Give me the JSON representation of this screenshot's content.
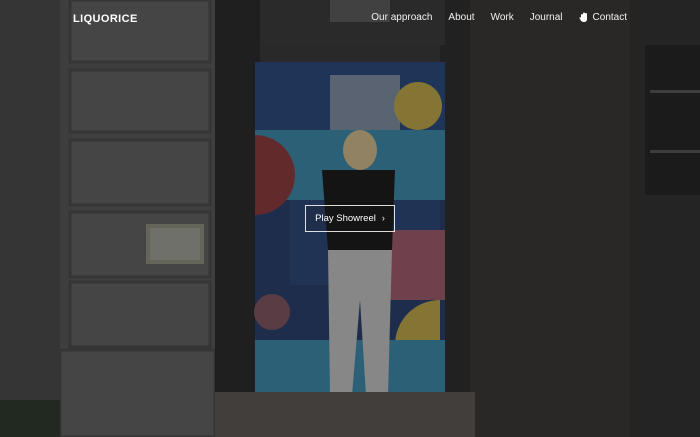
{
  "brand": {
    "logo": "LIQUORICE"
  },
  "nav": {
    "items": [
      {
        "label": "Our approach"
      },
      {
        "label": "About"
      },
      {
        "label": "Work"
      },
      {
        "label": "Journal"
      },
      {
        "label": "Contact",
        "icon": "hand-icon"
      }
    ]
  },
  "hero": {
    "cta_label": "Play Showreel",
    "cta_icon": "chevron-right-icon",
    "background_caption": "",
    "colors": {
      "overlay": "#2b2b2b",
      "mural_blue": "#3d86a6",
      "mural_red": "#8a3b3e",
      "mural_yellow": "#b8a24a",
      "mural_navy": "#2b3f6b"
    }
  }
}
